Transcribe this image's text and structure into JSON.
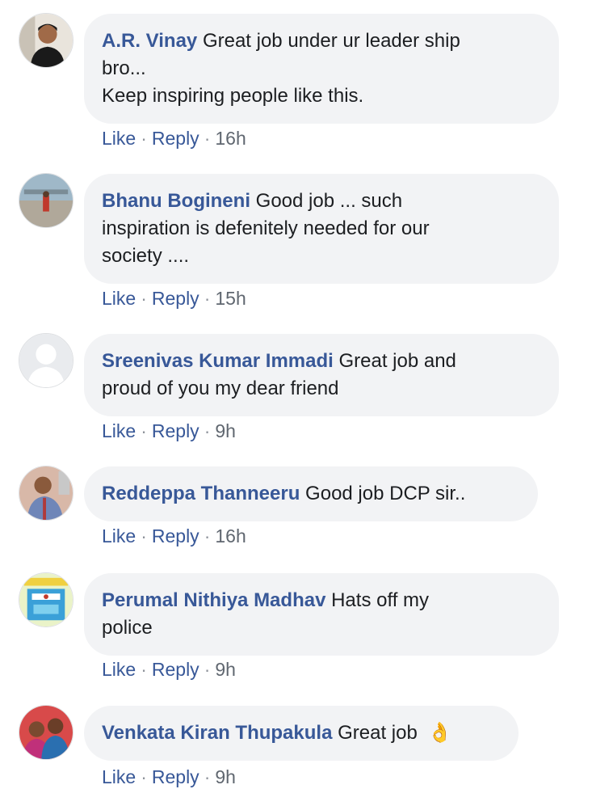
{
  "comments": [
    {
      "author": "A.R. Vinay",
      "text": "Great job under ur leader ship\nbro...\nKeep inspiring people like this.",
      "like": "Like",
      "reply": "Reply",
      "time": "16h"
    },
    {
      "author": "Bhanu Bogineni",
      "text": "Good job ... such\ninspiration is defenitely needed for our\nsociety ....",
      "like": "Like",
      "reply": "Reply",
      "time": "15h"
    },
    {
      "author": "Sreenivas Kumar Immadi",
      "text": "Great job and\nproud of you my dear friend",
      "like": "Like",
      "reply": "Reply",
      "time": "9h"
    },
    {
      "author": "Reddeppa Thanneeru",
      "text": "Good job DCP sir..",
      "like": "Like",
      "reply": "Reply",
      "time": "16h"
    },
    {
      "author": "Perumal Nithiya Madhav",
      "text": "Hats off my\npolice",
      "like": "Like",
      "reply": "Reply",
      "time": "9h"
    },
    {
      "author": "Venkata Kiran Thupakula",
      "text": "Great job",
      "emoji": "👌",
      "like": "Like",
      "reply": "Reply",
      "time": "9h"
    }
  ],
  "separator": "·",
  "colors": {
    "name_link": "#385898",
    "bubble_bg": "#f2f3f5",
    "meta_gray": "#90949c"
  }
}
